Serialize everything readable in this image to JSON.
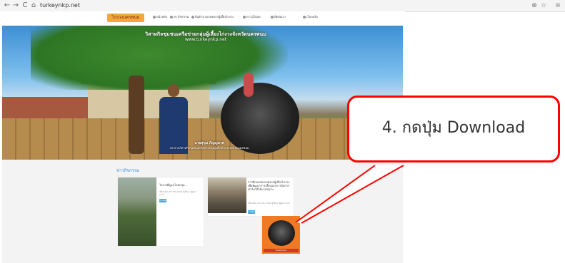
{
  "browser": {
    "back_icon": "back-arrow-icon",
    "forward_icon": "forward-arrow-icon",
    "reload_icon": "reload-icon",
    "home_icon": "home-icon",
    "url": "turkeynkp.net",
    "zoom_icon": "zoom-icon",
    "bookmark_icon": "star-icon",
    "menu_icon": "menu-icon"
  },
  "site": {
    "logo_text": "ไก่งวงนครพนม",
    "nav_items": [
      "หน้าหลัก",
      "ข่าวกิจกรรม",
      "สินค้าจากเกษตรกรผู้เลี้ยงไก่งวง",
      "ดาวน์โหลด",
      "ติดต่อเรา",
      "เว็บบอร์ด"
    ]
  },
  "hero": {
    "title": "วิสาหกิจชุมชนเครือข่ายกลุ่มผู้เลี้ยงไก่งวงจังหวัดนครพนม",
    "url_text": "www.turkeynkp.net",
    "caption_name": "นายสุขุม ภิญญมาศ",
    "caption_role": "ประธานวิสาหกิจชุมชนเครือข่ายกลุ่มผู้เลี้ยงไก่งวงจังหวัดนครพนม"
  },
  "news": {
    "heading": "ข่าวกิจกรรม",
    "cards": [
      {
        "title": "ไก่งวงที่ดูแลโดยกลุ่ม...",
        "meta": "เขียนเมื่อ มกราคม 2560 ผู้เขียน: ผู้ดูแลระบบ",
        "button": "อ่านต่อ"
      },
      {
        "title": "การฝึกอบรมเกษตรกรผู้เลี้ยงไก่งวงเพื่อพัฒนาการเลี้ยงและการจัดการฟาร์มให้ได้มาตรฐาน",
        "meta": "เขียนเมื่อ มกราคม 2560 ผู้เขียน: ผู้ดูแลระบบ",
        "button": "อ่านต่อ"
      }
    ],
    "download_thumb_label": "Download"
  },
  "callout": {
    "text": "4. กดปุ่ม Download"
  },
  "colors": {
    "callout_border": "#ff0000",
    "accent_blue": "#36a9e1",
    "thumb_orange": "#f07a23"
  }
}
